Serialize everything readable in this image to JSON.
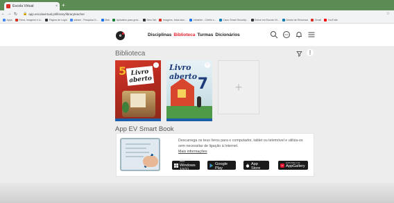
{
  "browser": {
    "tab_title": "Escola Virtual",
    "tab_close": "×",
    "new_tab": "+",
    "url": "app.escolavirtual.pt/library/libraryteacher",
    "bookmarks": [
      {
        "label": "Apps",
        "color": "#4285f4"
      },
      {
        "label": "Fotos, imagens e vi...",
        "color": "#d93025"
      },
      {
        "label": "Página de Login",
        "color": "#333333"
      },
      {
        "label": "sebani - Pesquisa G...",
        "color": "#4285f4"
      },
      {
        "label": "Blok",
        "color": "#1a73e8"
      },
      {
        "label": "Aplicativo para grav...",
        "color": "#188038"
      },
      {
        "label": "New Tab",
        "color": "#333333"
      },
      {
        "label": "Imagens, fotos stoc...",
        "color": "#d93025"
      },
      {
        "label": "Infoshim - Crietin o...",
        "color": "#1a73e8"
      },
      {
        "label": "Cisco Smart Security...",
        "color": "#0c7bb3"
      },
      {
        "label": "Entrar em Escola Vir...",
        "color": "#333333"
      },
      {
        "label": "Gestor de Recursos",
        "color": "#0c7bb3"
      },
      {
        "label": "Gmail",
        "color": "#d93025"
      },
      {
        "label": "YouTube",
        "color": "#ff0000"
      }
    ]
  },
  "header": {
    "logo_letter": "e",
    "nav": [
      "Disciplinas",
      "Biblioteca",
      "Turmas",
      "Dicionários"
    ],
    "active_nav": "Biblioteca",
    "icons": [
      "search-icon",
      "chat-icon",
      "bell-icon",
      "menu-icon"
    ]
  },
  "library": {
    "title": "Biblioteca",
    "more": "⋮",
    "books": [
      {
        "number": "5",
        "title_line1": "Livro",
        "title_line2": "aberto",
        "heart": "♡"
      },
      {
        "number": "7",
        "title": "Livro aberto",
        "heart": "♡"
      }
    ],
    "add_symbol": "+"
  },
  "promo": {
    "section_title": "App EV Smart Book",
    "text": "Descarrega os teus livros para o computador, tablet ou telemóvel e utiliza-os sem necessitar de ligação à Internet.",
    "link": "Mais informações",
    "stores": [
      {
        "small": "DESCARREGA PARA",
        "big": "Windows 10/11"
      },
      {
        "small": "DISPONÍVEL NO",
        "big": "Google Play"
      },
      {
        "small": "Descarregue na",
        "big": "App Store"
      },
      {
        "small": "EXPLORE-A NA",
        "big": "AppGallery"
      }
    ]
  }
}
